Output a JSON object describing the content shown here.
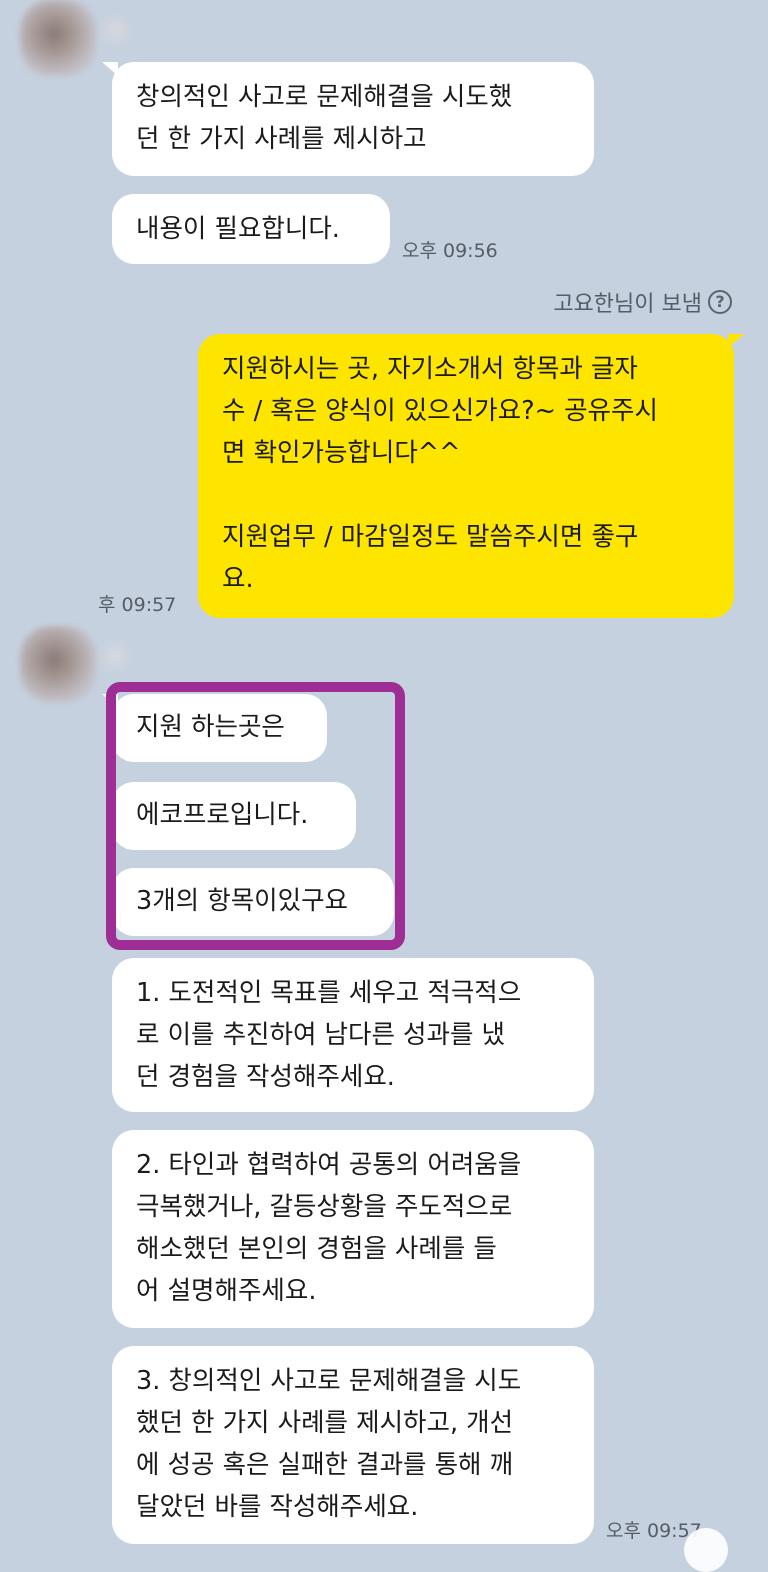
{
  "messages": {
    "m1": "창의적인 사고로 문제해결을 시도했\n던 한 가지 사례를 제시하고",
    "m2": "내용이 필요합니다.",
    "m2_time": "오후 09:56",
    "sender_note": "고요한님이 보냄",
    "m3": "지원하시는 곳, 자기소개서 항목과 글자\n수 / 혹은 양식이 있으신가요?~ 공유주시\n면 확인가능합니다^^\n\n지원업무 / 마감일정도 말씀주시면 좋구\n요.",
    "m3_time": "후 09:57",
    "m4": "지원 하는곳은",
    "m5": "에코프로입니다.",
    "m6": "3개의 항목이있구요",
    "m7": "1. 도전적인 목표를 세우고 적극적으\n로 이를 추진하여 남다른 성과를 냈\n던 경험을 작성해주세요.",
    "m8": "2. 타인과 협력하여 공통의 어려움을\n극복했거나, 갈등상황을 주도적으로\n해소했던 본인의 경험을 사례를 들\n어 설명해주세요.",
    "m9": "3. 창의적인 사고로 문제해결을 시도\n했던 한 가지 사례를 제시하고, 개선\n에 성공 혹은 실패한 결과를 통해 깨\n달았던 바를 작성해주세요.",
    "m9_time": "오후 09:57"
  },
  "icons": {
    "help": "question-circle-icon"
  },
  "colors": {
    "background": "#c6d1df",
    "incoming_bubble": "#ffffff",
    "outgoing_bubble": "#fee500",
    "highlight": "#9e2e96"
  }
}
